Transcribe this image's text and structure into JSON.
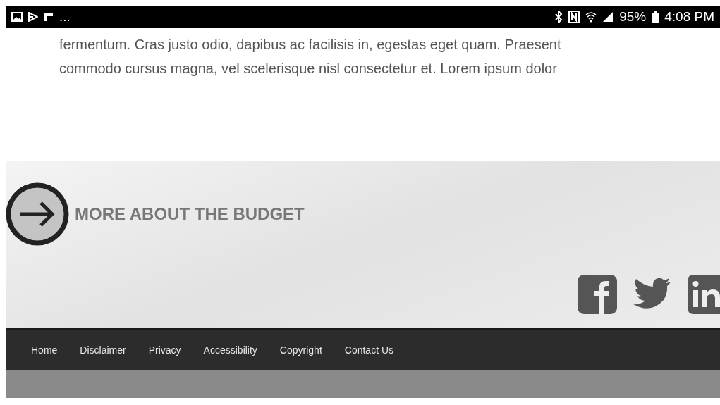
{
  "status_bar": {
    "overflow": "...",
    "battery": "95%",
    "time": "4:08 PM"
  },
  "article": {
    "lines": [
      "fermentum. Cras justo odio, dapibus ac facilisis in, egestas eget quam. Praesent",
      "commodo cursus magna, vel scelerisque nisl consectetur et. Lorem ipsum dolor"
    ]
  },
  "banner": {
    "link": "MORE ABOUT THE BUDGET"
  },
  "footer": {
    "links": [
      "Home",
      "Disclaimer",
      "Privacy",
      "Accessibility",
      "Copyright",
      "Contact Us"
    ]
  }
}
